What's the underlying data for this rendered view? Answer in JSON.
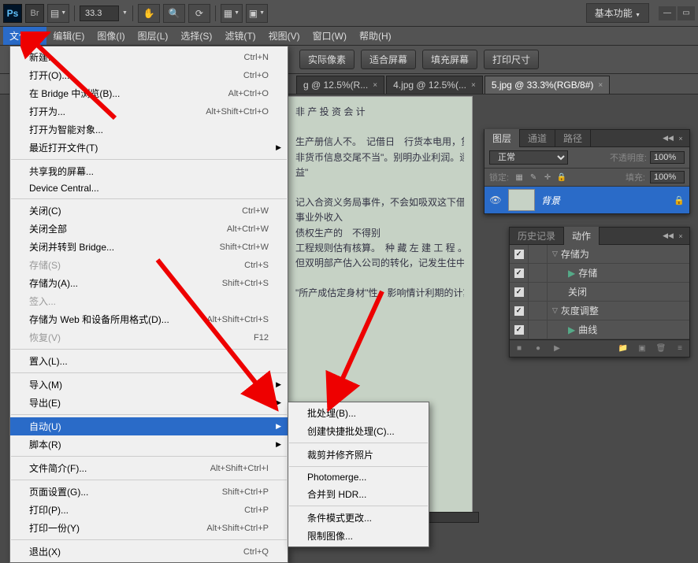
{
  "top": {
    "ps": "Ps",
    "br": "Br",
    "zoom": "33.3",
    "workspace": "基本功能"
  },
  "menubar": [
    "文件(F)",
    "编辑(E)",
    "图像(I)",
    "图层(L)",
    "选择(S)",
    "滤镜(T)",
    "视图(V)",
    "窗口(W)",
    "帮助(H)"
  ],
  "options": {
    "actual": "实际像素",
    "fit": "适合屏幕",
    "fill": "填充屏幕",
    "print": "打印尺寸"
  },
  "tabs": [
    {
      "label": "g @ 12.5%(R...",
      "active": false
    },
    {
      "label": "4.jpg @ 12.5%(...",
      "active": false
    },
    {
      "label": "5.jpg @ 33.3%(RGB/8#)",
      "active": true
    }
  ],
  "fileMenu": [
    {
      "label": "新建...",
      "shortcut": "Ctrl+N",
      "key": "new"
    },
    {
      "label": "打开(O)...",
      "shortcut": "Ctrl+O",
      "key": "open"
    },
    {
      "label": "在 Bridge 中浏览(B)...",
      "shortcut": "Alt+Ctrl+O",
      "key": "bridge"
    },
    {
      "label": "打开为...",
      "shortcut": "Alt+Shift+Ctrl+O",
      "key": "openas"
    },
    {
      "label": "打开为智能对象...",
      "key": "smart"
    },
    {
      "label": "最近打开文件(T)",
      "sub": true,
      "key": "recent"
    },
    {
      "sep": true
    },
    {
      "label": "共享我的屏幕...",
      "key": "share"
    },
    {
      "label": "Device Central...",
      "key": "device"
    },
    {
      "sep": true
    },
    {
      "label": "关闭(C)",
      "shortcut": "Ctrl+W",
      "key": "close"
    },
    {
      "label": "关闭全部",
      "shortcut": "Alt+Ctrl+W",
      "key": "closeall"
    },
    {
      "label": "关闭并转到 Bridge...",
      "shortcut": "Shift+Ctrl+W",
      "key": "closebr"
    },
    {
      "label": "存储(S)",
      "shortcut": "Ctrl+S",
      "disabled": true,
      "key": "save"
    },
    {
      "label": "存储为(A)...",
      "shortcut": "Shift+Ctrl+S",
      "key": "saveas"
    },
    {
      "label": "签入...",
      "disabled": true,
      "key": "checkin"
    },
    {
      "label": "存储为 Web 和设备所用格式(D)...",
      "shortcut": "Alt+Shift+Ctrl+S",
      "key": "saveweb"
    },
    {
      "label": "恢复(V)",
      "shortcut": "F12",
      "disabled": true,
      "key": "revert"
    },
    {
      "sep": true
    },
    {
      "label": "置入(L)...",
      "key": "place"
    },
    {
      "sep": true
    },
    {
      "label": "导入(M)",
      "sub": true,
      "key": "import"
    },
    {
      "label": "导出(E)",
      "sub": true,
      "key": "export"
    },
    {
      "sep": true
    },
    {
      "label": "自动(U)",
      "sub": true,
      "hl": true,
      "key": "auto"
    },
    {
      "label": "脚本(R)",
      "sub": true,
      "key": "script"
    },
    {
      "sep": true
    },
    {
      "label": "文件简介(F)...",
      "shortcut": "Alt+Shift+Ctrl+I",
      "key": "info"
    },
    {
      "sep": true
    },
    {
      "label": "页面设置(G)...",
      "shortcut": "Shift+Ctrl+P",
      "key": "page"
    },
    {
      "label": "打印(P)...",
      "shortcut": "Ctrl+P",
      "key": "print"
    },
    {
      "label": "打印一份(Y)",
      "shortcut": "Alt+Shift+Ctrl+P",
      "key": "print1"
    },
    {
      "sep": true
    },
    {
      "label": "退出(X)",
      "shortcut": "Ctrl+Q",
      "key": "exit"
    }
  ],
  "autoSubmenu": [
    {
      "label": "批处理(B)...",
      "key": "batch"
    },
    {
      "label": "创建快捷批处理(C)...",
      "key": "droplet"
    },
    {
      "sep": true
    },
    {
      "label": "裁剪并修齐照片",
      "key": "crop"
    },
    {
      "sep": true
    },
    {
      "label": "Photomerge...",
      "key": "pm"
    },
    {
      "label": "合并到 HDR...",
      "key": "hdr"
    },
    {
      "sep": true
    },
    {
      "label": "条件模式更改...",
      "key": "cond"
    },
    {
      "label": "限制图像...",
      "key": "fit"
    }
  ],
  "layersPanel": {
    "tabs": [
      "图层",
      "通道",
      "路径"
    ],
    "blend": "正常",
    "opacityLabel": "不透明度:",
    "opacity": "100%",
    "lockLabel": "锁定:",
    "fillLabel": "填充:",
    "fill": "100%",
    "layerName": "背景"
  },
  "historyPanel": {
    "tabs": [
      "历史记录",
      "动作"
    ],
    "rows": [
      {
        "check": true,
        "expand": "▽",
        "label": "存储为",
        "indent": 0
      },
      {
        "check": true,
        "play": true,
        "label": "存储",
        "indent": 1
      },
      {
        "check": true,
        "label": "关闭",
        "indent": 1
      },
      {
        "check": true,
        "expand": "▽",
        "label": "灰度调整",
        "indent": 0
      },
      {
        "check": true,
        "play": true,
        "label": "曲线",
        "indent": 1
      }
    ]
  }
}
